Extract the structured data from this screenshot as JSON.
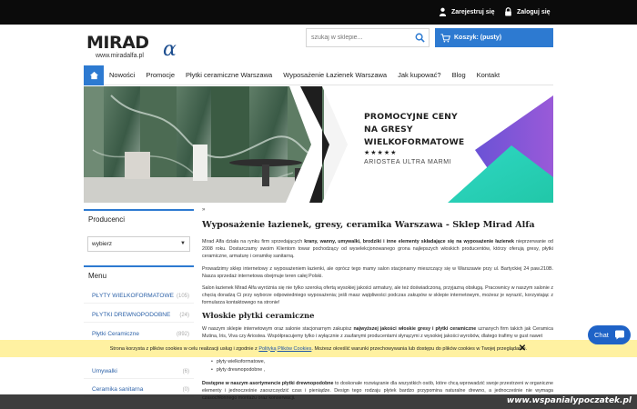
{
  "topbar": {
    "register_label": "Zarejestruj się",
    "login_label": "Zaloguj się"
  },
  "logo": {
    "main": "MIRAD",
    "alpha": "α",
    "url": "www.miradalfa.pl"
  },
  "search": {
    "placeholder": "szukaj w sklepie..."
  },
  "cart": {
    "label": "Koszyk: (pusty)"
  },
  "nav": {
    "items": [
      "Nowości",
      "Promocje",
      "Płytki ceramiczne Warszawa",
      "Wyposażenie Łazienek Warszawa",
      "Jak kupować?",
      "Blog",
      "Kontakt"
    ]
  },
  "banner": {
    "line1": "PROMOCYJNE CENY",
    "line2": "NA GRESY",
    "line3": "WIELKOFORMATOWE",
    "stars": "★★★★★",
    "line4": "ARIOSTEA ULTRA MARMI"
  },
  "sidebar": {
    "producers_title": "Producenci",
    "producers_select": "wybierz",
    "menu_title": "Menu",
    "items": [
      {
        "label": "PŁYTY WIELKOFORMATOWE",
        "count": "(105)"
      },
      {
        "label": "PŁYTKI DREWNOPODOBNE",
        "count": "(24)"
      },
      {
        "label": "Płytki Ceramiczne",
        "count": "(892)"
      },
      {
        "label": "Umywalki",
        "count": "(6)"
      },
      {
        "label": "Ceramika sanitarna",
        "count": "(0)"
      }
    ]
  },
  "content": {
    "breadcrumb": "»",
    "title": "Wyposażenie łazienek, gresy, ceramika Warszawa - Sklep Mirad Alfa",
    "p1_a": "Mirad Alfa działa na rynku firm sprzedających ",
    "p1_b": "krany, wanny, umywalki, brodziki i inne elementy składające się na wyposażenie łazienek",
    "p1_c": " nieprzerwanie od 2008 roku. Dostarczamy swoim Klientom towar pochodzący od wyselekcjonowanego grona najlepszych włoskich producentów, którzy oferują gresy, płytki ceramiczne, armaturę i ceramikę sanitarną.",
    "p2": "Prowadzimy sklep internetowy z wyposażeniem łazienki, ale oprócz tego mamy salon stacjonarny mieszczący się w Warszawie przy ul. Bartyckiej 24 paw.210B. Nasza sprzedaż internetowa obejmuje teren całej Polski.",
    "p3": "Salon łazienek Mirad Alfa wyróżnia się nie tylko szeroką ofertą wysokiej jakości armatury, ale też doświadczoną, przyjazną obsługą. Pracownicy w naszym salonie z chęcią doradzą Ci przy wyborze odpowiedniego wyposażenia; jeśli masz wątpliwości podczas zakupów w sklepie internetowym, możesz je wyrazić, korzystając z formularza kontaktowego na stronie!",
    "h2": "Włoskie płytki ceramiczne",
    "p4_a": "W naszym sklepie internetowym oraz salonie stacjonarnym zakupisz ",
    "p4_b": "najwyższej jakości włoskie gresy i płytki ceramiczne",
    "p4_c": " uznanych firm takich jak Ceramica Mutina, Iris, Viva czy Ariostea. Współpracujemy tylko i wyłącznie z zaufanymi producentami słynącymi z wysokiej jakości wyrobów, dlatego trafimy w gust nawet",
    "bullets": [
      "płyty wielkoformatowe,",
      "płyty drewnopodobne ,"
    ],
    "p5_a": "Dostępne w naszym asortymencie płytki drewnopodobne",
    "p5_b": " to doskonałe rozwiązanie dla wszystkich osób, które chcą wprowadzić swoje przestrzeni w organiczne elementy i jednocześnie zaoszczędzić czas i pieniądze. Design tego rodzaju płytek bardzo przypomina naturalne drewno, a jednocześnie nie wymaga czasochłonnego montażu oraz konserwacji."
  },
  "cookie": {
    "text_a": "Strona korzysta z plików cookies w celu realizacji usług i zgodnie z ",
    "link": "Polityką Plików Cookies",
    "text_b": ". Możesz określić warunki przechowywania lub dostępu do plików cookies w Twojej przeglądarce."
  },
  "chat": {
    "label": "Chat"
  },
  "watermark": {
    "text": "www.wspanialypoczatek.pl"
  },
  "colors": {
    "accent": "#2d7ad1",
    "topbar": "#0b0b0b",
    "cookie_bg": "#fff09d",
    "chat": "#1f63c7"
  }
}
